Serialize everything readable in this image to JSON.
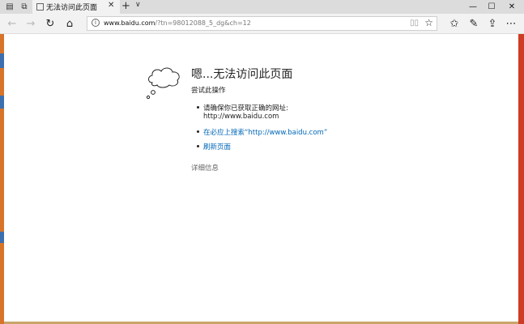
{
  "tab": {
    "title": "无法访问此页面"
  },
  "address": {
    "host": "www.baidu.com",
    "path": "/?tn=98012088_5_dg&ch=12"
  },
  "error": {
    "heading": "嗯...无法访问此页面",
    "subheading": "尝试此操作",
    "items": [
      {
        "text": "请确保你已获取正确的网址:"
      },
      {
        "text": "在必应上搜索“http://www.baidu.com”"
      },
      {
        "text": "刷新页面"
      }
    ],
    "url_line": "http://www.baidu.com",
    "details": "详细信息"
  },
  "icons": [
    "tab-aside-icon",
    "tab-preview-icon",
    "close-icon",
    "new-tab-icon",
    "tab-menu-icon",
    "minimize-icon",
    "maximize-icon",
    "close-window-icon",
    "back-icon",
    "forward-icon",
    "refresh-icon",
    "home-icon",
    "info-icon",
    "reading-view-icon",
    "favorite-star-icon",
    "favorites-hub-icon",
    "web-note-icon",
    "share-icon",
    "more-icon",
    "thought-cloud-icon"
  ],
  "colors": {
    "link": "#0067b8",
    "tabstrip": "#dcdcdc",
    "toolbar": "#f2f2f2"
  }
}
